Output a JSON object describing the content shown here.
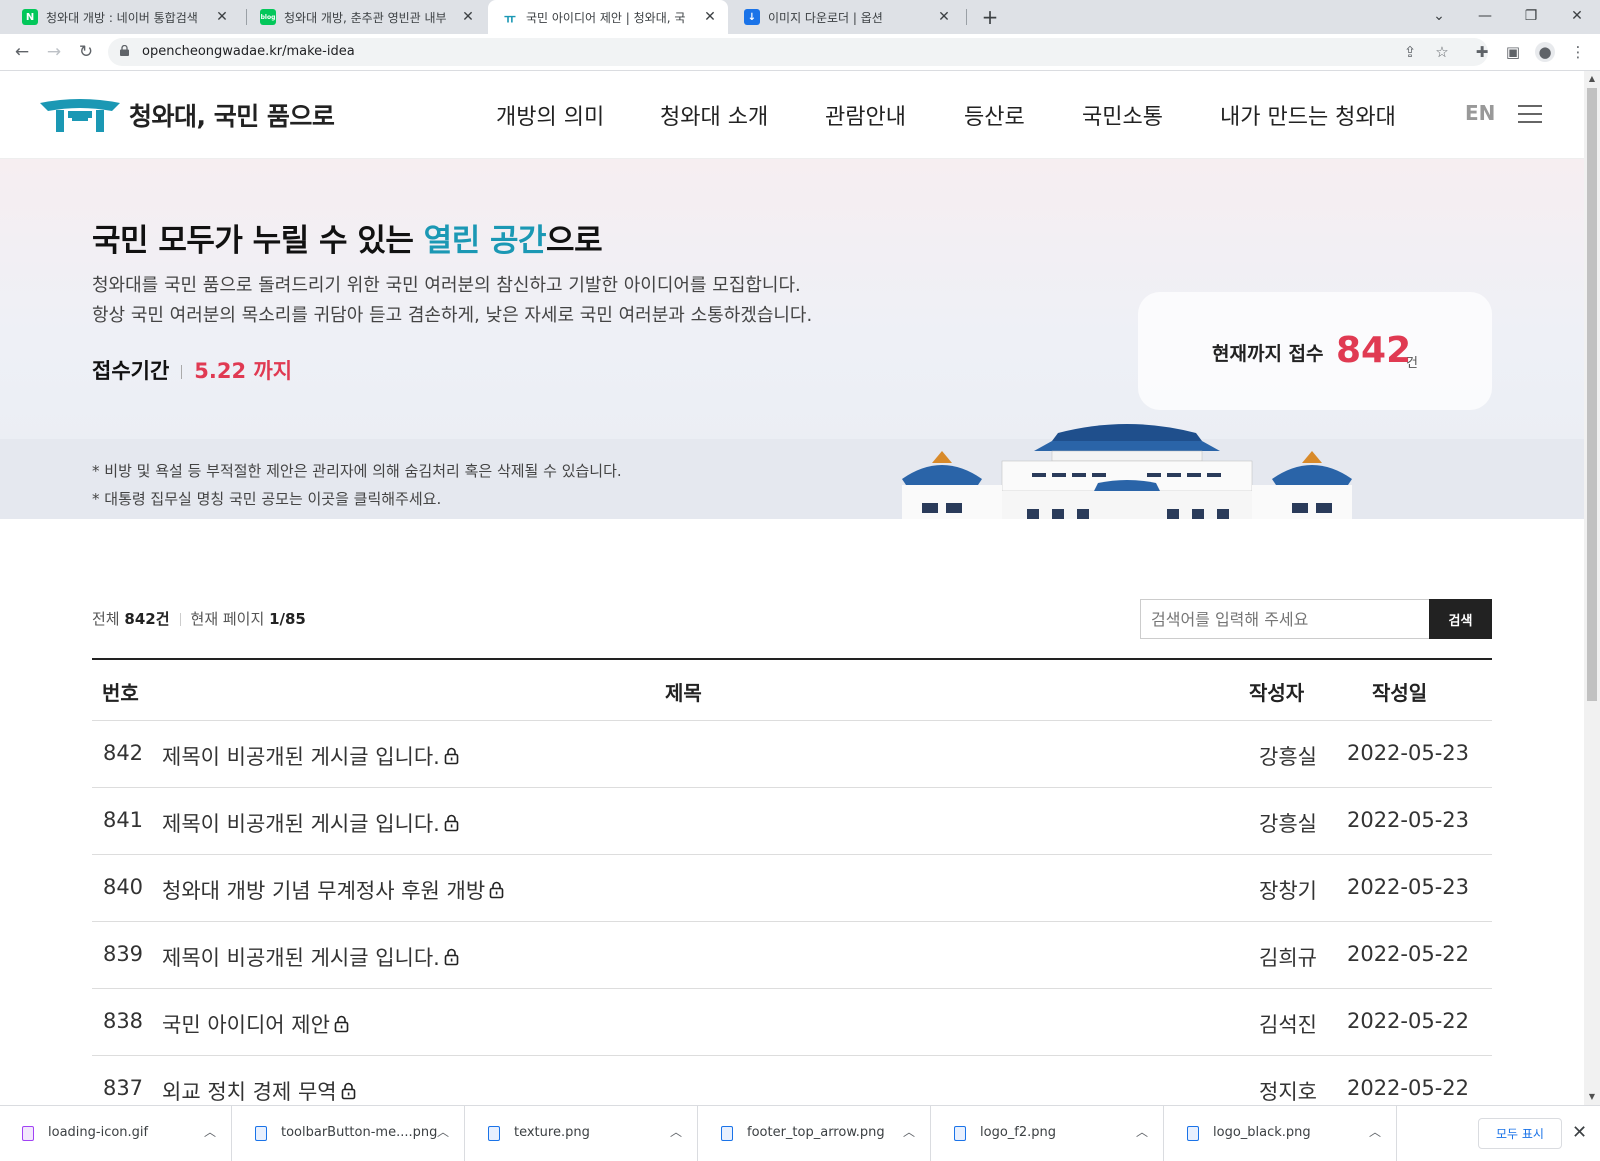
{
  "browser": {
    "tabs": [
      {
        "title": "청와대 개방 : 네이버 통합검색",
        "favicon": "naver-icon",
        "color": "#03c75a",
        "glyph": "N"
      },
      {
        "title": "청와대 개방, 춘추관 영빈관 내부",
        "favicon": "naver-blog-icon",
        "color": "#03c75a",
        "glyph": "blog"
      },
      {
        "title": "국민 아이디어 제안 | 청와대, 국",
        "favicon": "cheongwadae-icon",
        "color": "#1b98b4",
        "glyph": "ㅠ"
      },
      {
        "title": "이미지 다운로더 | 옵션",
        "favicon": "download-icon",
        "color": "#1a73e8",
        "glyph": "↓"
      }
    ],
    "url": "opencheongwadae.kr/make-idea"
  },
  "site": {
    "logo_text": "청와대, 국민 품으로",
    "nav": [
      "개방의 의미",
      "청와대 소개",
      "관람안내",
      "등산로",
      "국민소통",
      "내가 만드는 청와대"
    ],
    "lang": "EN"
  },
  "hero": {
    "title_pre": "국민 모두가 누릴 수 있는 ",
    "title_highlight": "열린 공간",
    "title_post": "으로",
    "desc1": "청와대를 국민 품으로 돌려드리기 위한 국민 여러분의 참신하고 기발한 아이디어를 모집합니다.",
    "desc2": "항상 국민 여러분의 목소리를 귀담아 듣고 겸손하게, 낮은 자세로 국민 여러분과 소통하겠습니다.",
    "period_label": "접수기간",
    "period_value": "5.22 까지",
    "count_label": "현재까지 접수",
    "count_value": "842",
    "count_unit": "건",
    "note1": "* 비방 및 욕설 등 부적절한 제안은 관리자에 의해 숨김처리 혹은 삭제될 수 있습니다.",
    "note2": "* 대통령 집무실 명칭 국민 공모는 이곳을 클릭해주세요."
  },
  "list": {
    "total_label": "전체",
    "total_value": "842건",
    "page_label": "현재 페이지",
    "page_value": "1/85",
    "search_placeholder": "검색어를 입력해 주세요",
    "search_button": "검색",
    "columns": [
      "번호",
      "제목",
      "작성자",
      "작성일"
    ],
    "rows": [
      {
        "no": "842",
        "title": "제목이 비공개된 게시글 입니다.",
        "author": "강흥실",
        "date": "2022-05-23"
      },
      {
        "no": "841",
        "title": "제목이 비공개된 게시글 입니다.",
        "author": "강흥실",
        "date": "2022-05-23"
      },
      {
        "no": "840",
        "title": "청와대 개방 기념 무계정사 후원 개방 ",
        "author": "장창기",
        "date": "2022-05-23"
      },
      {
        "no": "839",
        "title": "제목이 비공개된 게시글 입니다.",
        "author": "김희규",
        "date": "2022-05-22"
      },
      {
        "no": "838",
        "title": "국민 아이디어 제안 ",
        "author": "김석진",
        "date": "2022-05-22"
      },
      {
        "no": "837",
        "title": "외교 정치 경제 무역 ",
        "author": "정지호",
        "date": "2022-05-22"
      }
    ]
  },
  "downloads": {
    "items": [
      "loading-icon.gif",
      "toolbarButton-me....png",
      "texture.png",
      "footer_top_arrow.png",
      "logo_f2.png",
      "logo_black.png"
    ],
    "show_all": "모두 표시"
  },
  "colors": {
    "accent": "#1b98b4",
    "highlight_red": "#e03a52"
  }
}
